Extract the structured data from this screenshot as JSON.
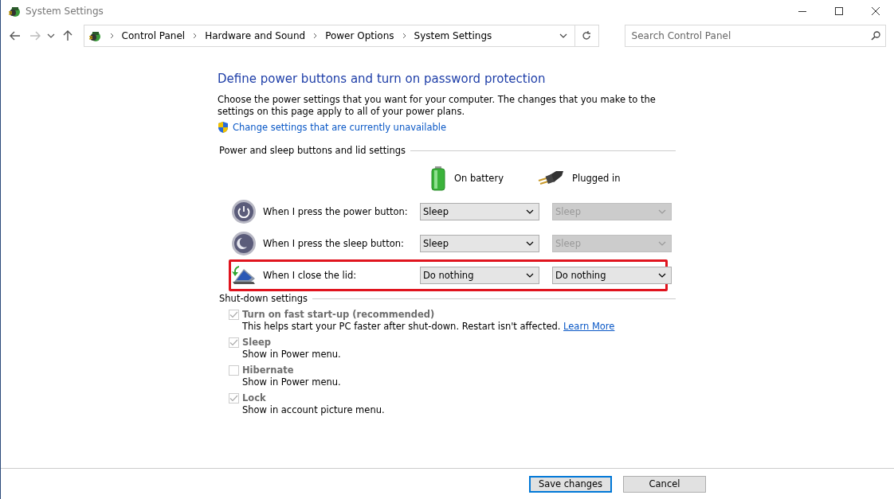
{
  "window": {
    "title": "System Settings"
  },
  "address_bar": {
    "crumbs": [
      "Control Panel",
      "Hardware and Sound",
      "Power Options",
      "System Settings"
    ]
  },
  "search": {
    "placeholder": "Search Control Panel"
  },
  "heading": "Define power buttons and turn on password protection",
  "intro": "Choose the power settings that you want for your computer. The changes that you make to the settings on this page apply to all of your power plans.",
  "admin_link": "Change settings that are currently unavailable",
  "buttons_section": {
    "title": "Power and sleep buttons and lid settings",
    "columns": [
      {
        "kind": "battery",
        "label": "On battery"
      },
      {
        "kind": "plug",
        "label": "Plugged in"
      }
    ],
    "rows": [
      {
        "kind": "power",
        "label": "When I press the power button:",
        "highlighted": false,
        "values": [
          {
            "value": "Sleep",
            "disabled": false
          },
          {
            "value": "Sleep",
            "disabled": true
          }
        ]
      },
      {
        "kind": "sleep",
        "label": "When I press the sleep button:",
        "highlighted": false,
        "values": [
          {
            "value": "Sleep",
            "disabled": false
          },
          {
            "value": "Sleep",
            "disabled": true
          }
        ]
      },
      {
        "kind": "lid",
        "label": "When I close the lid:",
        "highlighted": true,
        "values": [
          {
            "value": "Do nothing",
            "disabled": false
          },
          {
            "value": "Do nothing",
            "disabled": false
          }
        ]
      }
    ]
  },
  "shutdown_section": {
    "title": "Shut-down settings",
    "options": [
      {
        "label": "Turn on fast start-up (recommended)",
        "checked": true,
        "disabled": true,
        "description": "This helps start your PC faster after shut-down. Restart isn't affected.",
        "link": "Learn More"
      },
      {
        "label": "Sleep",
        "checked": true,
        "disabled": true,
        "description": "Show in Power menu."
      },
      {
        "label": "Hibernate",
        "checked": false,
        "disabled": true,
        "description": "Show in Power menu."
      },
      {
        "label": "Lock",
        "checked": true,
        "disabled": true,
        "description": "Show in account picture menu."
      }
    ]
  },
  "footer_buttons": [
    {
      "label": "Save changes",
      "default": true
    },
    {
      "label": "Cancel",
      "default": false
    }
  ]
}
